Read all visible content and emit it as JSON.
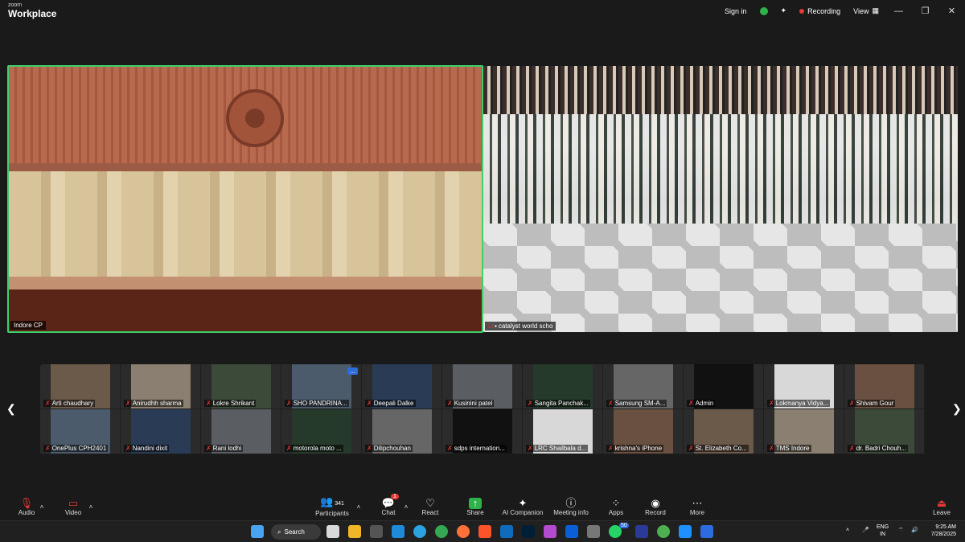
{
  "titlebar": {
    "logo_small": "zoom",
    "logo_big": "Workplace",
    "sign_in": "Sign in",
    "recording": "Recording",
    "view": "View"
  },
  "main_tiles": [
    {
      "label": "Indore CP"
    },
    {
      "label": "catalyst world scho"
    }
  ],
  "participants_strip": {
    "more_badge": "...",
    "rows": [
      [
        "Arti chaudhary",
        "Anirudhh sharma",
        "Lokre Shrikant",
        "SHO PANDRINA...",
        "Deepali Dalke",
        "Kusinini patel",
        "Sangita Panchak...",
        "Samsung SM-A...",
        "Admin",
        "Lokmanya Vidya...",
        "Shivam Gour"
      ],
      [
        "OnePlus CPH2401",
        "Nandini dixit",
        "Rani lodhi",
        "motorola moto ...",
        "Dilipchouhan",
        "sdps internation...",
        "LRC Shailbala d...",
        "krishna's iPhone",
        "St. Elizabeth Co...",
        "TMS Indore",
        "dr. Badri Chouh..."
      ]
    ]
  },
  "toolbar": {
    "audio": "Audio",
    "video": "Video",
    "participants": "Participants",
    "participant_count": "341",
    "chat": "Chat",
    "chat_badge": "1",
    "react": "React",
    "share": "Share",
    "ai": "AI Companion",
    "meeting_info": "Meeting info",
    "apps": "Apps",
    "record": "Record",
    "more": "More",
    "leave": "Leave"
  },
  "taskbar": {
    "search": "Search",
    "badge": "50",
    "lang1": "ENG",
    "lang2": "IN",
    "time": "9:25 AM",
    "date": "7/28/2025"
  },
  "colors": {
    "accent_green": "#3fcf6b",
    "mic_red": "#e53935",
    "zoom_blue": "#2d6cdf"
  }
}
